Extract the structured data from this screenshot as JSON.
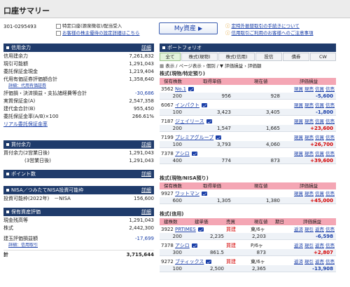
{
  "page": {
    "title": "口座サマリー"
  },
  "account": {
    "number": "301-0295493",
    "type_label": "特定口座(源泉徴収)/配当受入",
    "settings_link": "お客様の株主優待の設定詳細はこちら",
    "my_asset_button": "My資産"
  },
  "notices": [
    "定時外振替取引の手続きについて",
    "信用取引ご利用のお客様へのご注意事項"
  ],
  "credit_capacity": {
    "header": "信用余力",
    "detail": "詳細",
    "rows": [
      {
        "label": "信用建余力",
        "value": "7,261,832"
      },
      {
        "label": "現引可能額",
        "value": "1,291,043"
      },
      {
        "label": "委託保証金現金",
        "value": "1,219,404"
      },
      {
        "label": "代用有価証券評価額合計",
        "value": "1,358,640"
      },
      {
        "label": "詳細：代用有価証券",
        "value": ""
      },
      {
        "label": "評価損・決済損益・支払諸経費等合計",
        "value": "-30,686"
      },
      {
        "label": "実質保証金(A)",
        "value": "2,547,358"
      },
      {
        "label": "建代金合計(B)",
        "value": "955,450"
      },
      {
        "label": "委託保証金率(A/B)×100",
        "value": "266.61%"
      }
    ],
    "link": "リアル委託保証金率"
  },
  "buying_power": {
    "header": "買付余力",
    "detail": "詳細",
    "rows": [
      {
        "label": "買付余力(2営業日後)",
        "value": "1,291,043"
      },
      {
        "label": "(3営業日後)",
        "value": "1,291,043"
      }
    ]
  },
  "points": {
    "header": "ポイント数",
    "detail": "詳細"
  },
  "nisa": {
    "header": "NISA／つみたてNISA投資可能枠",
    "detail": "詳細",
    "rows": [
      {
        "label": "投資可能枠(2022年)　－NISA",
        "value": "156,600"
      }
    ]
  },
  "assets": {
    "header": "保有資産評価",
    "detail": "詳細",
    "rows": [
      {
        "label": "現金残高等",
        "value": "1,291,043"
      },
      {
        "label": "株式",
        "value": "2,442,300"
      },
      {
        "label": "建玉評価損益額",
        "value": "-17,699"
      },
      {
        "label": "詳細：信用取引",
        "value": ""
      },
      {
        "label": "計",
        "value": "3,715,644"
      }
    ]
  },
  "portfolio": {
    "header": "ポートフォリオ",
    "tabs": [
      "全て",
      "株式(現物)",
      "株式(信用)",
      "投信",
      "債券",
      "CW"
    ],
    "toolbar": [
      "表示",
      "ページ表示",
      "個別",
      "評価損益",
      "評価額"
    ],
    "spot_specific": {
      "title": "株式(現物/特定預り)",
      "columns": [
        "保有株数",
        "取得単価",
        "現在値",
        "評価損益"
      ],
      "actions": [
        "現買",
        "現売",
        "信買",
        "信売"
      ],
      "rows": [
        {
          "code": "3562",
          "name": "No.1",
          "qty": "200",
          "cost": "956",
          "price": "928",
          "pl": "-5,600"
        },
        {
          "code": "6067",
          "name": "インパクト",
          "qty": "100",
          "cost": "3,423",
          "price": "3,405",
          "pl": "-1,800"
        },
        {
          "code": "7187",
          "name": "ジェイリース",
          "qty": "200",
          "cost": "1,547",
          "price": "1,665",
          "pl": "+23,600"
        },
        {
          "code": "7199",
          "name": "プレミアグループ",
          "qty": "100",
          "cost": "3,793",
          "price": "4,060",
          "pl": "+26,700"
        },
        {
          "code": "7378",
          "name": "アシロ",
          "qty": "400",
          "cost": "774",
          "price": "873",
          "pl": "+39,600"
        }
      ]
    },
    "spot_nisa": {
      "title": "株式(現物/NISA預り)",
      "columns": [
        "保有株数",
        "取得単価",
        "現在値",
        "評価損益"
      ],
      "actions": [
        "現買",
        "現売",
        "信買",
        "信売"
      ],
      "rows": [
        {
          "code": "9927",
          "name": "ワットマン",
          "qty": "600",
          "cost": "1,305",
          "price": "1,380",
          "pl": "+45,000"
        }
      ]
    },
    "margin": {
      "title": "株式(信用)",
      "columns": [
        "建株数",
        "建単価",
        "売買",
        "現在値",
        "期日",
        "評価損益"
      ],
      "actions": [
        "返済",
        "現引",
        "返売",
        "信売"
      ],
      "rows": [
        {
          "code": "3922",
          "name": "PRTIMES",
          "qty": "200",
          "cost": "2,235",
          "side": "買建",
          "term": "東/6ヶ",
          "price": "2,203",
          "pl": "-6,598"
        },
        {
          "code": "7378",
          "name": "アシロ",
          "qty": "300",
          "cost": "861.5",
          "side": "買建",
          "term": "P/6ヶ",
          "price": "873",
          "pl": "+2,807"
        },
        {
          "code": "9272",
          "name": "ブティックス",
          "qty": "100",
          "cost": "2,500",
          "side": "買建",
          "term": "東/6ヶ",
          "price": "2,365",
          "pl": "-13,908"
        }
      ]
    }
  }
}
